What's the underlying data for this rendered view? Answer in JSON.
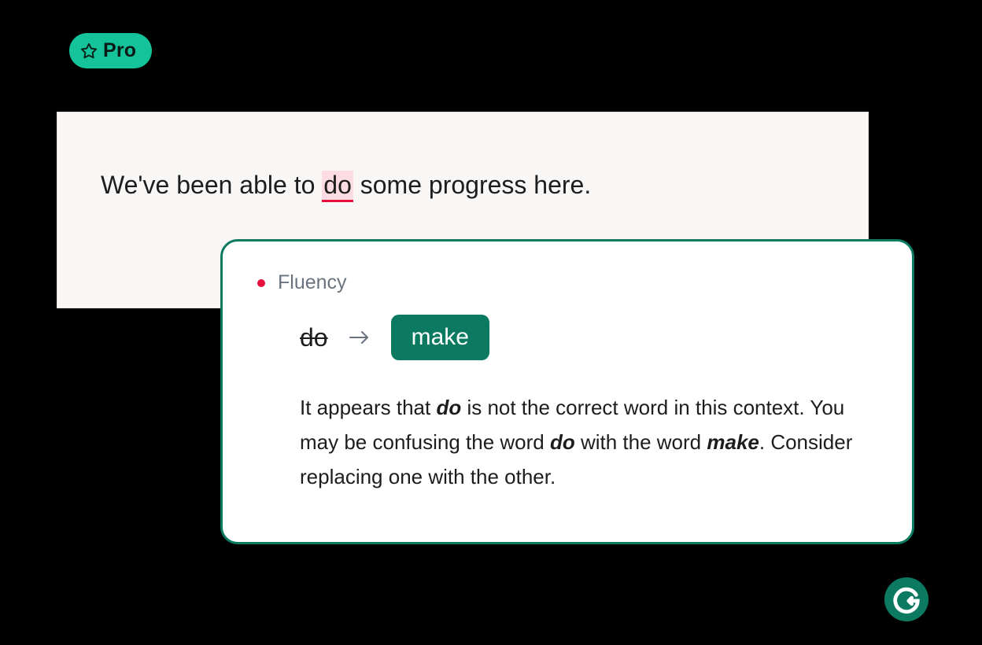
{
  "pro_badge": {
    "label": "Pro"
  },
  "text_card": {
    "sentence_before": "We've been able to ",
    "highlighted_word": "do",
    "sentence_after": " some progress here."
  },
  "suggestion": {
    "category": "Fluency",
    "original_word": "do",
    "suggested_word": "make",
    "explanation_parts": {
      "t1": "It appears that ",
      "w1": "do",
      "t2": " is not the correct word in this context. You may be confusing the word ",
      "w2": "do",
      "t3": " with the word ",
      "w3": "make",
      "t4": ". Consider replacing one with the other."
    }
  },
  "colors": {
    "badge_bg": "#15c39a",
    "brand_green": "#0b7a60",
    "error_red": "#e6103f",
    "highlight_pink": "#fddbe3"
  }
}
